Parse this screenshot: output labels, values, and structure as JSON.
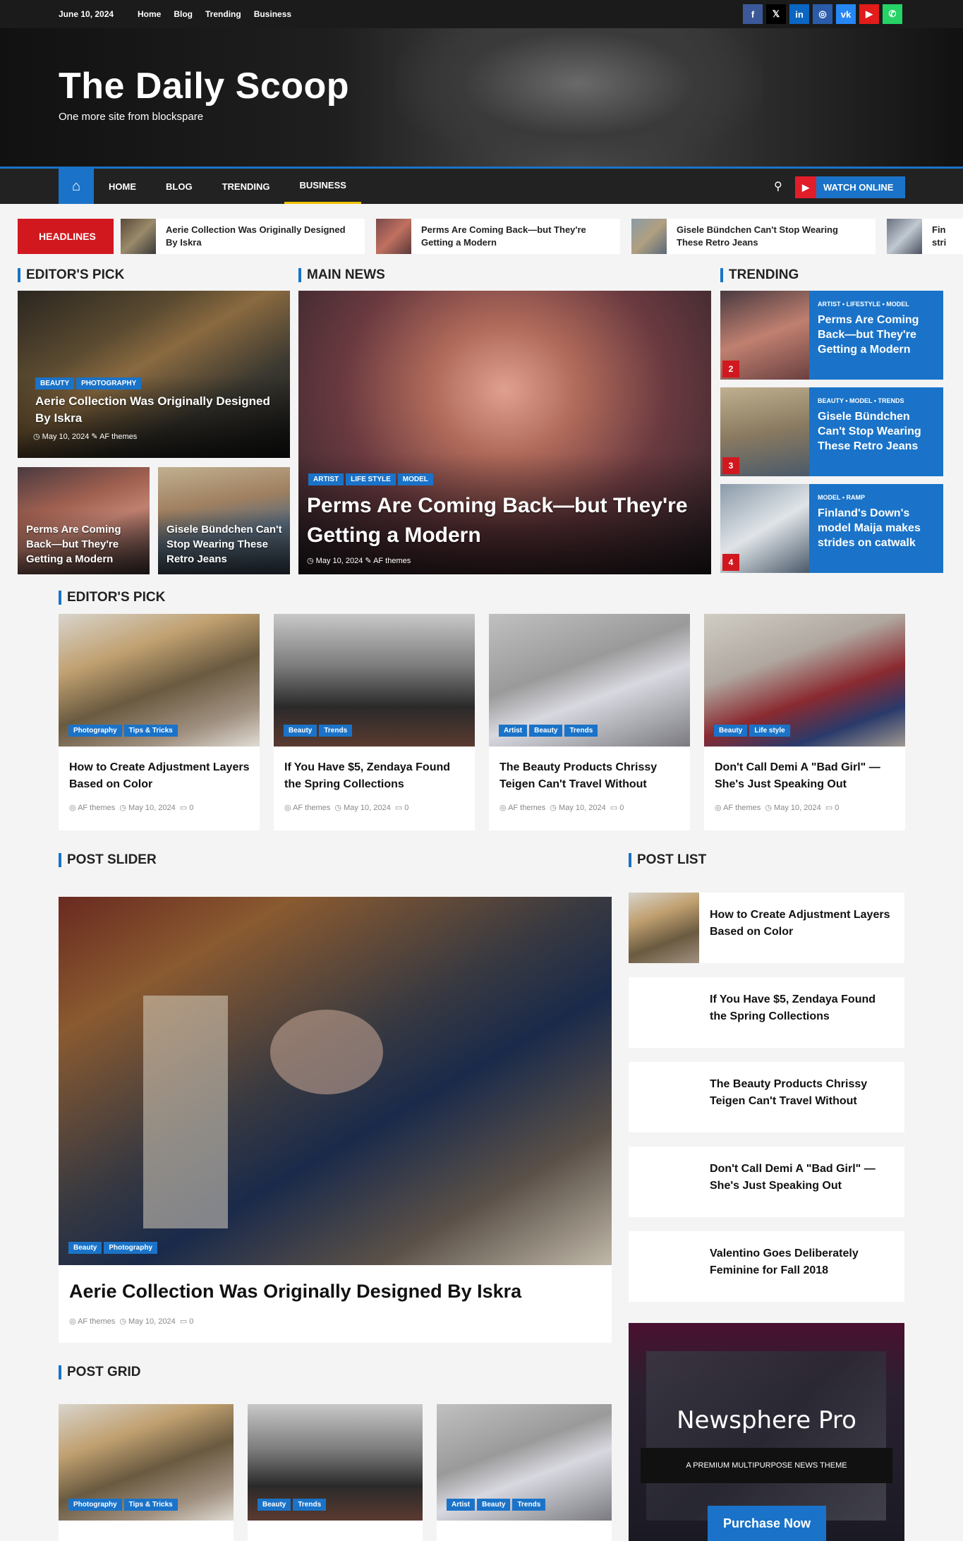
{
  "topbar": {
    "date": "June 10, 2024",
    "links": [
      "Home",
      "Blog",
      "Trending",
      "Business"
    ],
    "social": [
      {
        "name": "facebook-icon",
        "glyph": "f",
        "color": "#3b5998"
      },
      {
        "name": "x-icon",
        "glyph": "𝕏",
        "color": "#000000"
      },
      {
        "name": "linkedin-icon",
        "glyph": "in",
        "color": "#0a66c2"
      },
      {
        "name": "instagram-icon",
        "glyph": "◎",
        "color": "#2a5caa"
      },
      {
        "name": "vk-icon",
        "glyph": "vk",
        "color": "#2787f5"
      },
      {
        "name": "youtube-icon",
        "glyph": "▶",
        "color": "#e21b1b"
      },
      {
        "name": "whatsapp-icon",
        "glyph": "✆",
        "color": "#25d366"
      }
    ]
  },
  "header": {
    "title": "The Daily Scoop",
    "tagline": "One more site from blockspare"
  },
  "nav": {
    "items": [
      "HOME",
      "BLOG",
      "TRENDING",
      "BUSINESS"
    ],
    "watch_label": "WATCH ONLINE"
  },
  "ticker": {
    "label": "HEADLINES",
    "items": [
      "Aerie Collection Was Originally Designed By Iskra",
      "Perms Are Coming Back—but They're Getting a Modern",
      "Gisele Bündchen Can't Stop Wearing These Retro Jeans",
      "Fin stri"
    ]
  },
  "sections": {
    "editors_pick": "EDITOR'S PICK",
    "main_news": "MAIN NEWS",
    "trending": "TRENDING",
    "editors_pick_2": "EDITOR'S PICK",
    "post_slider": "POST SLIDER",
    "post_list": "POST LIST",
    "post_grid": "POST GRID"
  },
  "editors_pick": {
    "main": {
      "cats": [
        "BEAUTY",
        "PHOTOGRAPHY"
      ],
      "title": "Aerie Collection Was Originally Designed By Iskra",
      "date": "May 10, 2024",
      "author": "AF themes"
    },
    "small": [
      {
        "title": "Perms Are Coming Back—but They're Getting a Modern"
      },
      {
        "title": "Gisele Bündchen Can't Stop Wearing These Retro Jeans"
      }
    ]
  },
  "main_news": {
    "cats": [
      "ARTIST",
      "LIFE STYLE",
      "MODEL"
    ],
    "title": "Perms Are Coming Back—but They're Getting a Modern",
    "date": "May 10, 2024",
    "author": "AF themes"
  },
  "trending": [
    {
      "cats": "ARTIST • LIFESTYLE • MODEL",
      "title": "Perms Are Coming Back—but They're Getting a Modern",
      "num": "2"
    },
    {
      "cats": "BEAUTY • MODEL • TRENDS",
      "title": "Gisele Bündchen Can't Stop Wearing These Retro Jeans",
      "num": "3"
    },
    {
      "cats": "MODEL • RAMP",
      "title": "Finland's Down's model Maija makes strides on catwalk",
      "num": "4"
    }
  ],
  "editors_cards": [
    {
      "cats": [
        "Photography",
        "Tips & Tricks"
      ],
      "title": "How to Create Adjustment Layers Based on Color",
      "author": "AF themes",
      "date": "May 10, 2024",
      "comments": "0"
    },
    {
      "cats": [
        "Beauty",
        "Trends"
      ],
      "title": "If You Have $5, Zendaya Found the Spring Collections",
      "author": "AF themes",
      "date": "May 10, 2024",
      "comments": "0"
    },
    {
      "cats": [
        "Artist",
        "Beauty",
        "Trends"
      ],
      "title": "The Beauty Products Chrissy Teigen Can't Travel Without",
      "author": "AF themes",
      "date": "May 10, 2024",
      "comments": "0"
    },
    {
      "cats": [
        "Beauty",
        "Life style"
      ],
      "title": "Don't Call Demi A \"Bad Girl\" — She's Just Speaking Out",
      "author": "AF themes",
      "date": "May 10, 2024",
      "comments": "0"
    }
  ],
  "slider": {
    "cats": [
      "Beauty",
      "Photography"
    ],
    "title": "Aerie Collection Was Originally Designed By Iskra",
    "author": "AF themes",
    "date": "May 10, 2024",
    "comments": "0"
  },
  "post_list": [
    "How to Create Adjustment Layers Based on Color",
    "If You Have $5, Zendaya Found the Spring Collections",
    "The Beauty Products Chrissy Teigen Can't Travel Without",
    "Don't Call Demi A \"Bad Girl\" — She's Just Speaking Out",
    "Valentino Goes Deliberately Feminine for Fall 2018"
  ],
  "ad": {
    "title": "Newsphere Pro",
    "subtitle": "A PREMIUM MULTIPURPOSE NEWS THEME",
    "button": "Purchase Now"
  },
  "grid": [
    {
      "cats": [
        "Photography",
        "Tips & Tricks"
      ]
    },
    {
      "cats": [
        "Beauty",
        "Trends"
      ]
    },
    {
      "cats": [
        "Artist",
        "Beauty",
        "Trends"
      ]
    }
  ]
}
